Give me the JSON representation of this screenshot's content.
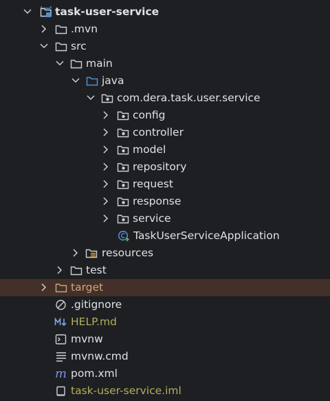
{
  "project_tree": {
    "root": {
      "label": "task-user-service",
      "expanded": true
    },
    "mvn": {
      "label": ".mvn",
      "expanded": false
    },
    "src": {
      "label": "src",
      "expanded": true
    },
    "main": {
      "label": "main",
      "expanded": true
    },
    "java": {
      "label": "java",
      "expanded": true
    },
    "package": {
      "label": "com.dera.task.user.service",
      "expanded": true
    },
    "packages": [
      {
        "label": "config"
      },
      {
        "label": "controller"
      },
      {
        "label": "model"
      },
      {
        "label": "repository"
      },
      {
        "label": "request"
      },
      {
        "label": "response"
      },
      {
        "label": "service"
      }
    ],
    "app_class": {
      "label": "TaskUserServiceApplication"
    },
    "resources": {
      "label": "resources",
      "expanded": false
    },
    "test": {
      "label": "test",
      "expanded": false
    },
    "target": {
      "label": "target",
      "expanded": false,
      "selected": true
    },
    "files": {
      "gitignore": {
        "label": ".gitignore"
      },
      "help": {
        "label": "HELP.md"
      },
      "mvnw": {
        "label": "mvnw"
      },
      "mvnw_cmd": {
        "label": "mvnw.cmd"
      },
      "pom": {
        "label": "pom.xml"
      },
      "iml": {
        "label": "task-user-service.iml"
      }
    }
  },
  "colors": {
    "background": "#1e1f22",
    "text": "#dfe1e5",
    "selected_row": "#43302a",
    "excluded_text": "#d3a37d",
    "modified_text": "#b3ae60",
    "source_folder": "#4e8fd6"
  },
  "icons": {
    "module": "module-folder-icon",
    "folder": "folder-icon",
    "source_folder": "source-folder-icon",
    "package": "package-icon",
    "spring_class": "spring-boot-class-icon",
    "resources": "resources-folder-icon",
    "excluded": "excluded-folder-icon",
    "ignore": "ignore-file-icon",
    "markdown": "markdown-icon",
    "shell": "shell-script-icon",
    "text": "text-file-icon",
    "maven": "maven-icon",
    "iml": "iml-file-icon"
  }
}
